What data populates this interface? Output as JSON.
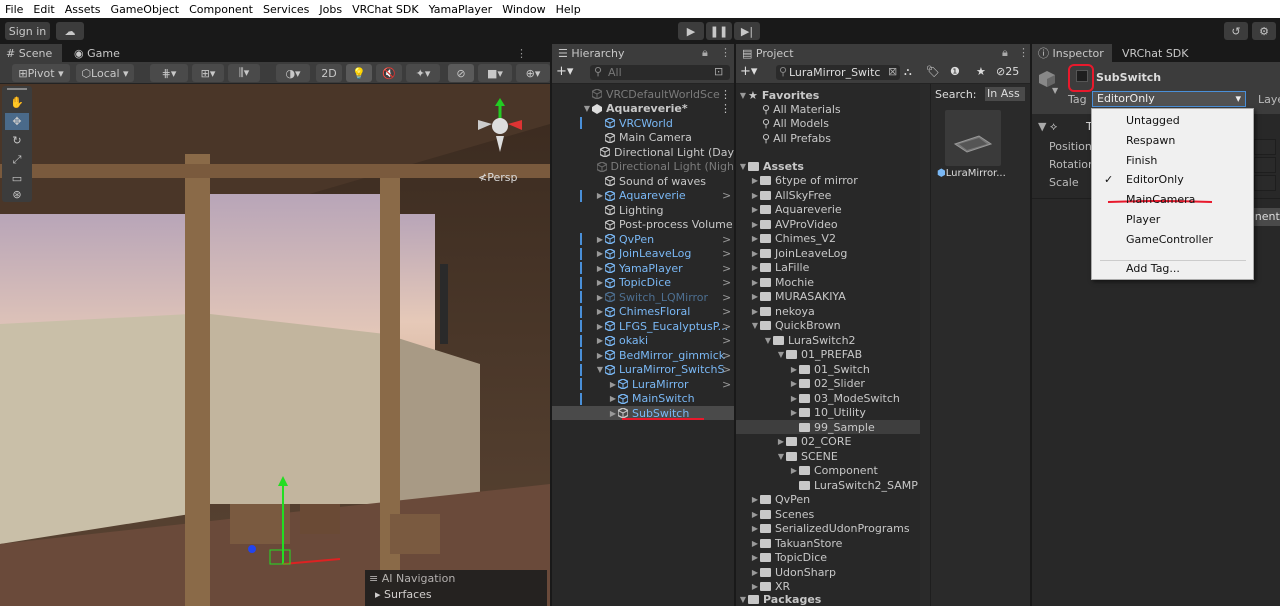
{
  "menu": [
    "File",
    "Edit",
    "Assets",
    "GameObject",
    "Component",
    "Services",
    "Jobs",
    "VRChat SDK",
    "YamaPlayer",
    "Window",
    "Help"
  ],
  "toolbar": {
    "signin": "Sign in"
  },
  "scene": {
    "tab_scene": "Scene",
    "tab_game": "Game",
    "pivot": "Pivot",
    "local": "Local",
    "mode_2d": "2D",
    "persp": "Persp",
    "overlay_title": "AI Navigation",
    "overlay_item": "Surfaces"
  },
  "hierarchy": {
    "tab": "Hierarchy",
    "search_placeholder": "All",
    "rows": [
      {
        "label": "VRCDefaultWorldSce",
        "depth": 0,
        "style": "dim",
        "icon": "cube"
      },
      {
        "label": "Aquareverie*",
        "depth": 0,
        "style": "bold",
        "icon": "unity"
      },
      {
        "label": "VRCWorld",
        "depth": 1,
        "style": "blue",
        "icon": "cube"
      },
      {
        "label": "Main Camera",
        "depth": 1,
        "style": "normal",
        "icon": "cube"
      },
      {
        "label": "Directional Light (Day",
        "depth": 1,
        "style": "normal",
        "icon": "cube"
      },
      {
        "label": "Directional Light (Nigh",
        "depth": 1,
        "style": "dim",
        "icon": "cube"
      },
      {
        "label": "Sound of waves",
        "depth": 1,
        "style": "normal",
        "icon": "cube"
      },
      {
        "label": "Aquareverie",
        "depth": 1,
        "style": "blue",
        "icon": "cube"
      },
      {
        "label": "Lighting",
        "depth": 1,
        "style": "normal",
        "icon": "cube"
      },
      {
        "label": "Post-process Volume",
        "depth": 1,
        "style": "normal",
        "icon": "cube"
      },
      {
        "label": "QvPen",
        "depth": 1,
        "style": "blue",
        "icon": "cube"
      },
      {
        "label": "JoinLeaveLog",
        "depth": 1,
        "style": "blue",
        "icon": "cube"
      },
      {
        "label": "YamaPlayer",
        "depth": 1,
        "style": "blue",
        "icon": "cube"
      },
      {
        "label": "TopicDice",
        "depth": 1,
        "style": "blue",
        "icon": "cube"
      },
      {
        "label": "Switch_LQMirror",
        "depth": 1,
        "style": "dimblue",
        "icon": "cube"
      },
      {
        "label": "ChimesFloral",
        "depth": 1,
        "style": "blue",
        "icon": "cube"
      },
      {
        "label": "LFGS_EucalyptusP...",
        "depth": 1,
        "style": "blue",
        "icon": "cube"
      },
      {
        "label": "okaki",
        "depth": 1,
        "style": "blue",
        "icon": "cube"
      },
      {
        "label": "BedMirror_gimmick",
        "depth": 1,
        "style": "blue",
        "icon": "cube"
      },
      {
        "label": "LuraMirror_SwitchS",
        "depth": 1,
        "style": "blue",
        "icon": "cube"
      },
      {
        "label": "LuraMirror",
        "depth": 2,
        "style": "blue",
        "icon": "cube"
      },
      {
        "label": "MainSwitch",
        "depth": 2,
        "style": "blue",
        "icon": "cube"
      },
      {
        "label": "SubSwitch",
        "depth": 2,
        "style": "selected",
        "icon": "cube"
      }
    ]
  },
  "project": {
    "tab": "Project",
    "search_value": "LuraMirror_Switc",
    "count": "25",
    "search_label": "Search:",
    "search_scope": "In Ass",
    "asset_label": "LuraMirror...",
    "favorites_header": "Favorites",
    "favorites": [
      "All Materials",
      "All Models",
      "All Prefabs"
    ],
    "assets_header": "Assets",
    "tree": [
      {
        "label": "6type of mirror",
        "depth": 1
      },
      {
        "label": "AllSkyFree",
        "depth": 1
      },
      {
        "label": "Aquareverie",
        "depth": 1
      },
      {
        "label": "AVProVideo",
        "depth": 1
      },
      {
        "label": "Chimes_V2",
        "depth": 1
      },
      {
        "label": "JoinLeaveLog",
        "depth": 1
      },
      {
        "label": "LaFille",
        "depth": 1
      },
      {
        "label": "Mochie",
        "depth": 1
      },
      {
        "label": "MURASAKIYA",
        "depth": 1
      },
      {
        "label": "nekoya",
        "depth": 1
      },
      {
        "label": "QuickBrown",
        "depth": 1
      },
      {
        "label": "LuraSwitch2",
        "depth": 2
      },
      {
        "label": "01_PREFAB",
        "depth": 3
      },
      {
        "label": "01_Switch",
        "depth": 4
      },
      {
        "label": "02_Slider",
        "depth": 4
      },
      {
        "label": "03_ModeSwitch",
        "depth": 4
      },
      {
        "label": "10_Utility",
        "depth": 4
      },
      {
        "label": "99_Sample",
        "depth": 4
      },
      {
        "label": "02_CORE",
        "depth": 3
      },
      {
        "label": "SCENE",
        "depth": 3
      },
      {
        "label": "Component",
        "depth": 4
      },
      {
        "label": "LuraSwitch2_SAMP",
        "depth": 4
      },
      {
        "label": "QvPen",
        "depth": 1
      },
      {
        "label": "Scenes",
        "depth": 1
      },
      {
        "label": "SerializedUdonPrograms",
        "depth": 1
      },
      {
        "label": "TakuanStore",
        "depth": 1
      },
      {
        "label": "TopicDice",
        "depth": 1
      },
      {
        "label": "UdonSharp",
        "depth": 1
      },
      {
        "label": "XR",
        "depth": 1
      }
    ],
    "packages_header": "Packages",
    "packages_first": "AI Navigation"
  },
  "inspector": {
    "tab": "Inspector",
    "tab2": "VRChat SDK",
    "object_name": "SubSwitch",
    "tag_label": "Tag",
    "tag_value": "EditorOnly",
    "layer_label": "Laye",
    "transform_letter": "T",
    "position": "Position",
    "rotation": "Rotation",
    "scale": "Scale",
    "add_component_fragment": "onent"
  },
  "tag_dropdown": {
    "items": [
      "Untagged",
      "Respawn",
      "Finish",
      "EditorOnly",
      "MainCamera",
      "Player",
      "GameController"
    ],
    "selected": "EditorOnly",
    "add": "Add Tag..."
  },
  "colors": {
    "annotation_red": "#e8192c",
    "link_blue": "#7ab8f5",
    "selection": "#4a4a4a"
  }
}
